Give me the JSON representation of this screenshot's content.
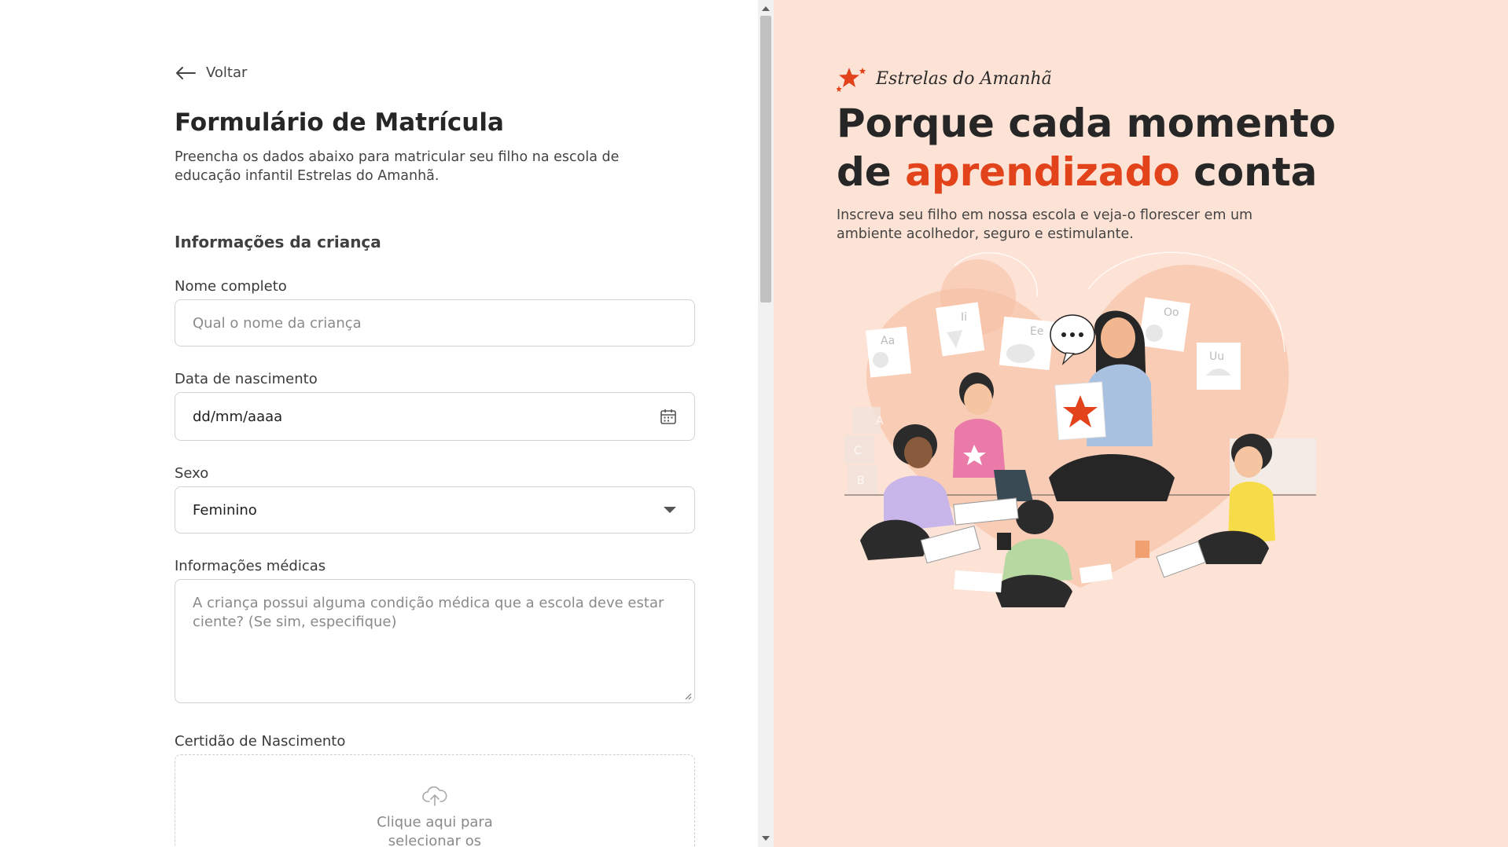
{
  "form": {
    "back_label": "Voltar",
    "title": "Formulário de Matrícula",
    "description": "Preencha os dados abaixo para matricular seu filho na escola de educação infantil Estrelas do Amanhã.",
    "section_child_title": "Informações da criança",
    "fields": {
      "full_name": {
        "label": "Nome completo",
        "placeholder": "Qual o nome da criança"
      },
      "birth_date": {
        "label": "Data de nascimento",
        "value": "dd/mm/aaaa"
      },
      "sex": {
        "label": "Sexo",
        "value": "Feminino"
      },
      "medical": {
        "label": "Informações médicas",
        "placeholder": "A criança possui alguma condição médica que a escola deve estar ciente? (Se sim, especifique)"
      },
      "birth_certificate": {
        "label": "Certidão de Nascimento",
        "upload_text": "Clique aqui para selecionar os arquivos"
      }
    }
  },
  "hero": {
    "brand_name": "Estrelas do Amanhã",
    "title_part1": "Porque cada momento de ",
    "title_accent": "aprendizado",
    "title_part2": " conta",
    "subtitle": "Inscreva seu filho em nossa escola e veja-o florescer em um ambiente acolhedor, seguro e estimulante.",
    "illustration_cards": [
      "Aa",
      "Ii",
      "Ee",
      "Oo",
      "Uu"
    ],
    "illustration_blocks": [
      "A",
      "C",
      "B"
    ]
  },
  "colors": {
    "accent": "#e2431b",
    "hero_background": "#fde3d5",
    "heart_shape": "#f9cdb5",
    "input_border": "#d3d3d3"
  },
  "icons": {
    "back": "arrow-left-icon",
    "calendar": "calendar-icon",
    "dropdown": "caret-down-icon",
    "upload": "cloud-upload-icon",
    "brand": "star-logo-icon"
  }
}
